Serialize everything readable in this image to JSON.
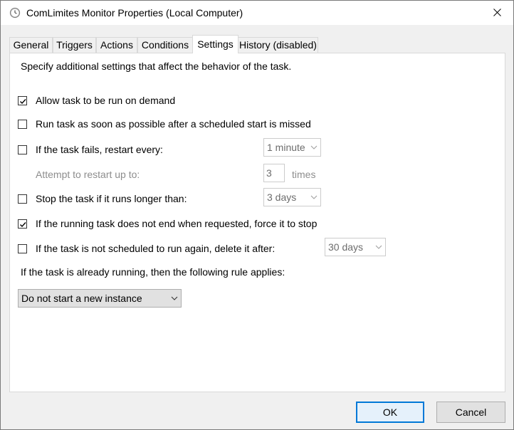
{
  "window": {
    "title": "ComLimites Monitor Properties (Local Computer)",
    "app_icon": "clock-icon",
    "close_icon": "close-icon"
  },
  "tabs": [
    {
      "label": "General",
      "active": false
    },
    {
      "label": "Triggers",
      "active": false
    },
    {
      "label": "Actions",
      "active": false
    },
    {
      "label": "Conditions",
      "active": false
    },
    {
      "label": "Settings",
      "active": true
    },
    {
      "label": "History (disabled)",
      "active": false
    }
  ],
  "settings": {
    "intro": "Specify additional settings that affect the behavior of the task.",
    "allow_on_demand": {
      "label": "Allow task to be run on demand",
      "checked": true
    },
    "run_asap": {
      "label": "Run task as soon as possible after a scheduled start is missed",
      "checked": false
    },
    "restart_on_fail": {
      "label": "If the task fails, restart every:",
      "checked": false,
      "interval": "1 minute"
    },
    "restart_attempts": {
      "label": "Attempt to restart up to:",
      "value": "3",
      "unit": "times"
    },
    "stop_if_longer": {
      "label": "Stop the task if it runs longer than:",
      "checked": false,
      "duration": "3 days"
    },
    "force_stop": {
      "label": "If the running task does not end when requested, force it to stop",
      "checked": true
    },
    "delete_after": {
      "label": "If the task is not scheduled to run again, delete it after:",
      "checked": false,
      "duration": "30 days"
    },
    "rule_label": "If the task is already running, then the following rule applies:",
    "rule_value": "Do not start a new instance"
  },
  "buttons": {
    "ok": "OK",
    "cancel": "Cancel"
  },
  "colors": {
    "accent": "#0078d7",
    "disabled_text": "#8d8d8d"
  }
}
